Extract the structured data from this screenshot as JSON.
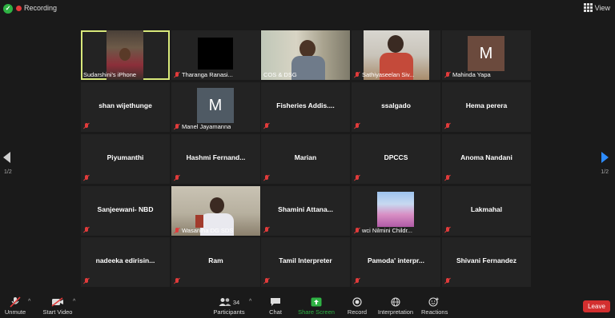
{
  "topbar": {
    "recording_label": "Recording",
    "view_label": "View"
  },
  "pager": {
    "left": "1/2",
    "right": "1/2"
  },
  "tiles": {
    "t1": "Sudarshini's iPhone",
    "t2": "Tharanga Ranasi...",
    "t3": "COS & DSG",
    "t4": "Sathiyaseelan Siv...",
    "t5": "Mahinda Yapa",
    "t5_initial": "M",
    "t6": "shan wijethunge",
    "t7": "Manel Jayamanna",
    "t7_initial": "M",
    "t8": "Fisheries Addis....",
    "t9": "ssalgado",
    "t10": "Hema perera",
    "t11": "Piyumanthi",
    "t12": "Hashmi Fernand...",
    "t13": "Marian",
    "t14": "DPCCS",
    "t15": "Anoma Nandani",
    "t16": "Sanjeewani- NBD",
    "t17": "Wasantha DG SDS",
    "t18": "Shamini Attana...",
    "t19": "wci Nilmini Childr...",
    "t20": "Lakmahal",
    "t21": "nadeeka edirisin...",
    "t22": "Ram",
    "t23": "Tamil Interpreter",
    "t24": "Pamoda' interpr...",
    "t25": "Shivani Fernandez"
  },
  "toolbar": {
    "unmute": "Unmute",
    "start_video": "Start Video",
    "participants": "Participants",
    "participants_count": "34",
    "chat": "Chat",
    "share_screen": "Share Screen",
    "record": "Record",
    "interpretation": "Interpretation",
    "reactions": "Reactions",
    "leave": "Leave"
  },
  "colors": {
    "active_speaker": "#d8e87a",
    "share_green": "#2fb344",
    "leave_red": "#d32f2f",
    "nav_blue": "#2d8cff",
    "avatar_brown": "#6b4a3d",
    "avatar_slate": "#4f5a64"
  }
}
